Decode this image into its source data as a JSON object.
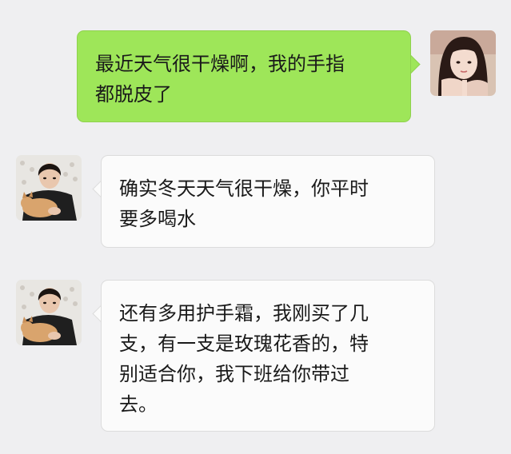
{
  "chat": {
    "messages": [
      {
        "sender": "self",
        "avatar_icon": "girl-avatar",
        "lines": [
          "最近天气很干燥啊，我的手指",
          "都脱皮了"
        ]
      },
      {
        "sender": "other",
        "avatar_icon": "man-with-cat-avatar",
        "lines": [
          "确实冬天天气很干燥，你平时",
          "要多喝水"
        ]
      },
      {
        "sender": "other",
        "avatar_icon": "man-with-cat-avatar",
        "lines": [
          "还有多用护手霜，我刚买了几",
          "支，有一支是玫瑰花香的，特",
          "别适合你，我下班给你带过",
          "去。"
        ]
      }
    ]
  },
  "colors": {
    "background": "#efeff1",
    "self_bubble": "#9ee659",
    "other_bubble": "#fbfbfb"
  }
}
